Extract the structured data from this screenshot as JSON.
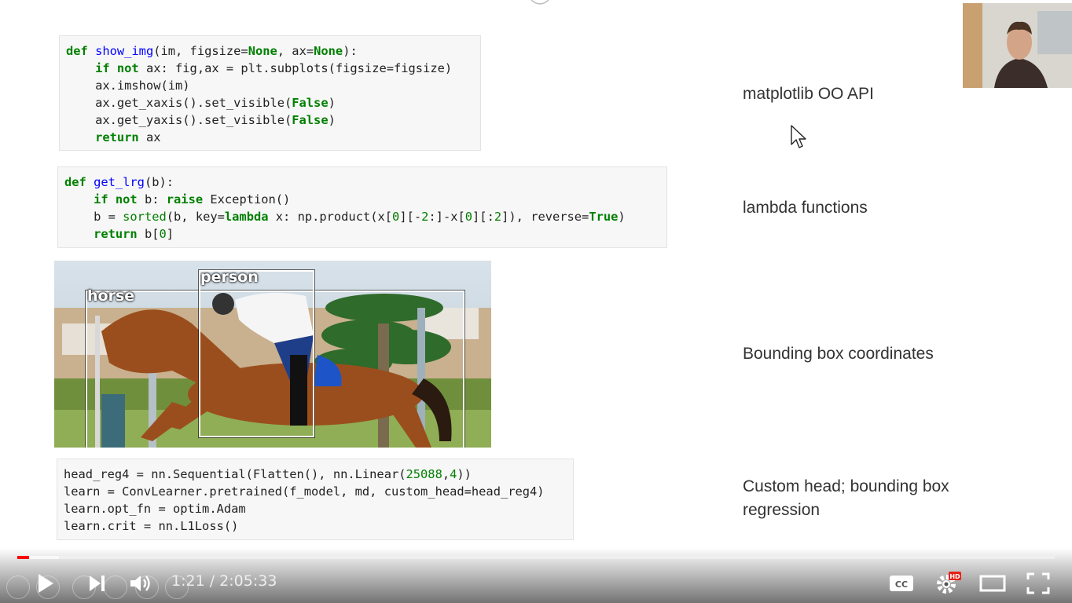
{
  "code_cells": {
    "show_img": [
      [
        {
          "t": "def ",
          "c": "kw"
        },
        {
          "t": "show_img",
          "c": "fn"
        },
        {
          "t": "(im, figsize=",
          "c": ""
        },
        {
          "t": "None",
          "c": "kw"
        },
        {
          "t": ", ax=",
          "c": ""
        },
        {
          "t": "None",
          "c": "kw"
        },
        {
          "t": "):",
          "c": ""
        }
      ],
      [
        {
          "t": "    ",
          "c": ""
        },
        {
          "t": "if not",
          "c": "kw"
        },
        {
          "t": " ax: fig,ax = plt.subplots(figsize=figsize)",
          "c": ""
        }
      ],
      [
        {
          "t": "    ax.imshow(im)",
          "c": ""
        }
      ],
      [
        {
          "t": "    ax.get_xaxis().set_visible(",
          "c": ""
        },
        {
          "t": "False",
          "c": "kw"
        },
        {
          "t": ")",
          "c": ""
        }
      ],
      [
        {
          "t": "    ax.get_yaxis().set_visible(",
          "c": ""
        },
        {
          "t": "False",
          "c": "kw"
        },
        {
          "t": ")",
          "c": ""
        }
      ],
      [
        {
          "t": "    ",
          "c": ""
        },
        {
          "t": "return",
          "c": "kw"
        },
        {
          "t": " ax",
          "c": ""
        }
      ]
    ],
    "get_lrg": [
      [
        {
          "t": "def ",
          "c": "kw"
        },
        {
          "t": "get_lrg",
          "c": "fn"
        },
        {
          "t": "(b):",
          "c": ""
        }
      ],
      [
        {
          "t": "    ",
          "c": ""
        },
        {
          "t": "if not",
          "c": "kw"
        },
        {
          "t": " b: ",
          "c": ""
        },
        {
          "t": "raise",
          "c": "kw"
        },
        {
          "t": " Exception()",
          "c": ""
        }
      ],
      [
        {
          "t": "    b = ",
          "c": ""
        },
        {
          "t": "sorted",
          "c": "bi"
        },
        {
          "t": "(b, key=",
          "c": ""
        },
        {
          "t": "lambda",
          "c": "kw"
        },
        {
          "t": " x: np.product(x[",
          "c": ""
        },
        {
          "t": "0",
          "c": "num"
        },
        {
          "t": "][-",
          "c": ""
        },
        {
          "t": "2",
          "c": "num"
        },
        {
          "t": ":]-x[",
          "c": ""
        },
        {
          "t": "0",
          "c": "num"
        },
        {
          "t": "][:",
          "c": ""
        },
        {
          "t": "2",
          "c": "num"
        },
        {
          "t": "]), reverse=",
          "c": ""
        },
        {
          "t": "True",
          "c": "kw"
        },
        {
          "t": ")",
          "c": ""
        }
      ],
      [
        {
          "t": "    ",
          "c": ""
        },
        {
          "t": "return",
          "c": "kw"
        },
        {
          "t": " b[",
          "c": ""
        },
        {
          "t": "0",
          "c": "num"
        },
        {
          "t": "]",
          "c": ""
        }
      ]
    ],
    "head_reg4": [
      [
        {
          "t": "head_reg4 = nn.Sequential(Flatten(), nn.Linear(",
          "c": ""
        },
        {
          "t": "25088",
          "c": "num"
        },
        {
          "t": ",",
          "c": ""
        },
        {
          "t": "4",
          "c": "num"
        },
        {
          "t": "))",
          "c": ""
        }
      ],
      [
        {
          "t": "learn = ConvLearner.pretrained(f_model, md, custom_head=head_reg4)",
          "c": ""
        }
      ],
      [
        {
          "t": "learn.opt_fn = optim.Adam",
          "c": ""
        }
      ],
      [
        {
          "t": "learn.crit = nn.L1Loss()",
          "c": ""
        }
      ]
    ]
  },
  "notes": {
    "oo_api": "matplotlib OO API",
    "lambda": "lambda functions",
    "bbox": "Bounding box coordinates",
    "custom_head_line1": "Custom head; bounding box",
    "custom_head_line2": "regression"
  },
  "image": {
    "label_horse": "horse",
    "label_person": "person"
  },
  "player": {
    "current_time": "1:21",
    "separator": " / ",
    "duration": "2:05:33",
    "progress_fraction": 0.011,
    "buffered_fraction": 0.04,
    "played_color": "#ff0000",
    "cc_label": "CC",
    "hd_badge": "HD",
    "icons": [
      "play-icon",
      "next-icon",
      "volume-icon",
      "captions-icon",
      "settings-icon",
      "theater-icon",
      "fullscreen-icon"
    ]
  }
}
